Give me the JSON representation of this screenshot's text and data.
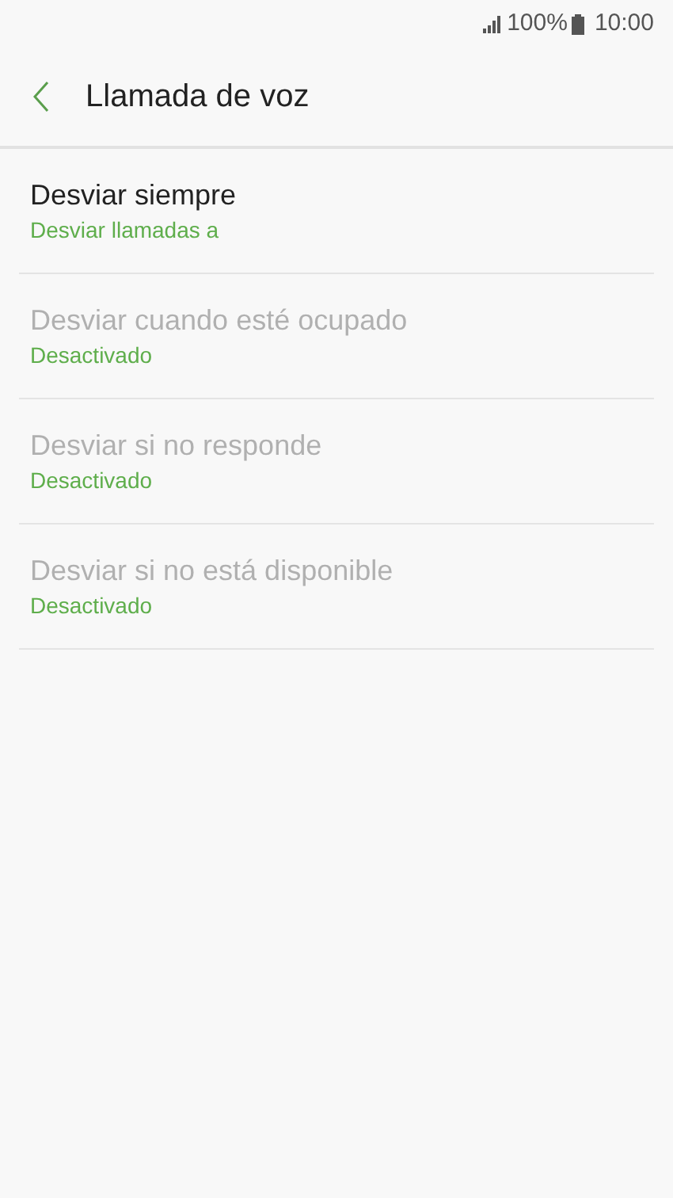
{
  "status_bar": {
    "battery": "100%",
    "time": "10:00"
  },
  "header": {
    "title": "Llamada de voz"
  },
  "items": [
    {
      "title": "Desviar siempre",
      "summary": "Desviar llamadas a",
      "disabled": false
    },
    {
      "title": "Desviar cuando esté ocupado",
      "summary": "Desactivado",
      "disabled": true
    },
    {
      "title": "Desviar si no responde",
      "summary": "Desactivado",
      "disabled": true
    },
    {
      "title": "Desviar si no está disponible",
      "summary": "Desactivado",
      "disabled": true
    }
  ]
}
